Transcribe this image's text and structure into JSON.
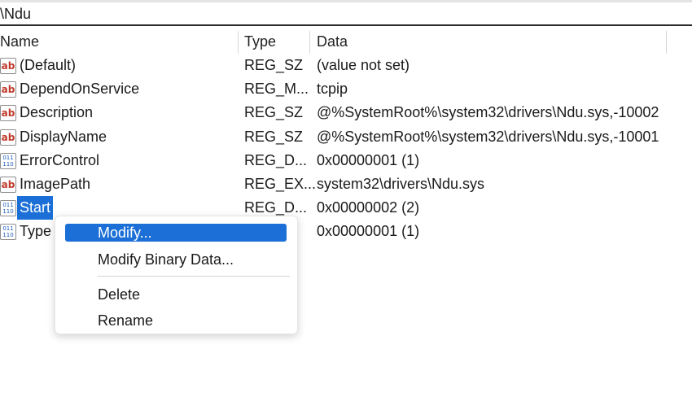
{
  "address": {
    "path": "\\Ndu"
  },
  "columns": {
    "name": "Name",
    "type": "Type",
    "data": "Data"
  },
  "rows": [
    {
      "icon": "string-value-icon",
      "glyph": "ab",
      "name": "(Default)",
      "type": "REG_SZ",
      "data": "(value not set)"
    },
    {
      "icon": "string-value-icon",
      "glyph": "ab",
      "name": "DependOnService",
      "type": "REG_M...",
      "data": "tcpip"
    },
    {
      "icon": "string-value-icon",
      "glyph": "ab",
      "name": "Description",
      "type": "REG_SZ",
      "data": "@%SystemRoot%\\system32\\drivers\\Ndu.sys,-10002"
    },
    {
      "icon": "string-value-icon",
      "glyph": "ab",
      "name": "DisplayName",
      "type": "REG_SZ",
      "data": "@%SystemRoot%\\system32\\drivers\\Ndu.sys,-10001"
    },
    {
      "icon": "binary-value-icon",
      "glyph": "",
      "name": "ErrorControl",
      "type": "REG_D...",
      "data": "0x00000001 (1)"
    },
    {
      "icon": "string-value-icon",
      "glyph": "ab",
      "name": "ImagePath",
      "type": "REG_EX...",
      "data": "system32\\drivers\\Ndu.sys"
    },
    {
      "icon": "binary-value-icon",
      "glyph": "",
      "name": "Start",
      "type": "REG_D...",
      "data": "0x00000002 (2)",
      "selected": true
    },
    {
      "icon": "binary-value-icon",
      "glyph": "",
      "name": "Type",
      "type": "",
      "data": "0x00000001 (1)"
    }
  ],
  "context_menu": {
    "items": [
      {
        "label": "Modify...",
        "active": true
      },
      {
        "label": "Modify Binary Data...",
        "active": false
      },
      {
        "label": "Delete",
        "active": false
      },
      {
        "label": "Rename",
        "active": false
      }
    ]
  },
  "colors": {
    "selection": "#1b6fd6",
    "string_icon": "#c0392b",
    "binary_icon": "#1d5fb8"
  }
}
